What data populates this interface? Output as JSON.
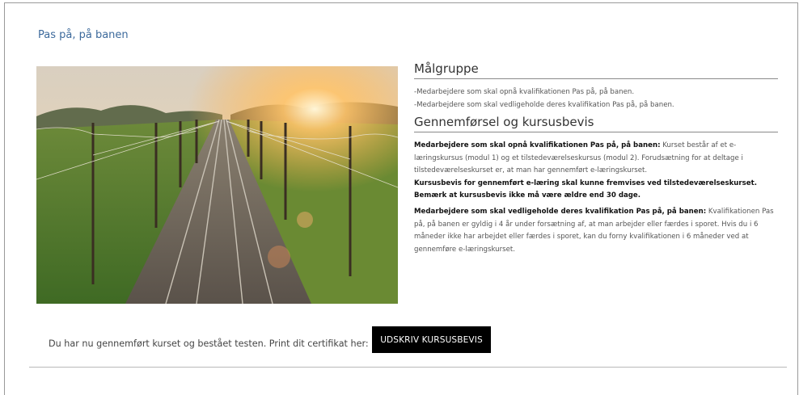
{
  "page": {
    "title": "Pas på, på banen"
  },
  "hero": {
    "alt": "Jernbanespor med køreledninger i solnedgang"
  },
  "malgruppe": {
    "heading": "Målgruppe",
    "lines": [
      "-Medarbejdere som skal opnå kvalifikationen Pas på, på banen.",
      "-Medarbejdere som skal vedligeholde deres kvalifikation Pas på, på banen."
    ]
  },
  "gennemforsel": {
    "heading": "Gennemførsel og kursusbevis",
    "block1_bold": "Medarbejdere som skal opnå kvalifikationen Pas på, på banen:",
    "block1_text": " Kurset består af et e-læringskursus (modul 1) og et tilstedeværelseskursus (modul 2). Forudsætning for at deltage i tilstedeværelseskurset er, at man har gennemført e-læringskurset.",
    "block1_strong1": "Kursusbevis for gennemført e-læring skal kunne fremvises ved tilstedeværelseskurset.",
    "block1_strong2": "Bemærk at kursusbevis ikke må være ældre end 30 dage.",
    "block2_bold": "Medarbejdere som skal vedligeholde deres kvalifikation Pas på, på banen:",
    "block2_text": " Kvalifikationen Pas på, på banen er gyldig i 4 år under forsætning af, at man arbejder eller færdes i sporet. Hvis du i 6 måneder ikke har arbejdet eller færdes i sporet, kan du forny kvalifikationen i 6 måneder ved at gennemføre e-læringskurset."
  },
  "certificate": {
    "text": "Du har nu gennemført kurset og bestået testen. Print dit certifikat her:",
    "button_label": "UDSKRIV KURSUSBEVIS",
    "button_bg": "#000000"
  },
  "colors": {
    "title": "#3d6a9c",
    "heading": "#333333",
    "body": "#555555"
  }
}
